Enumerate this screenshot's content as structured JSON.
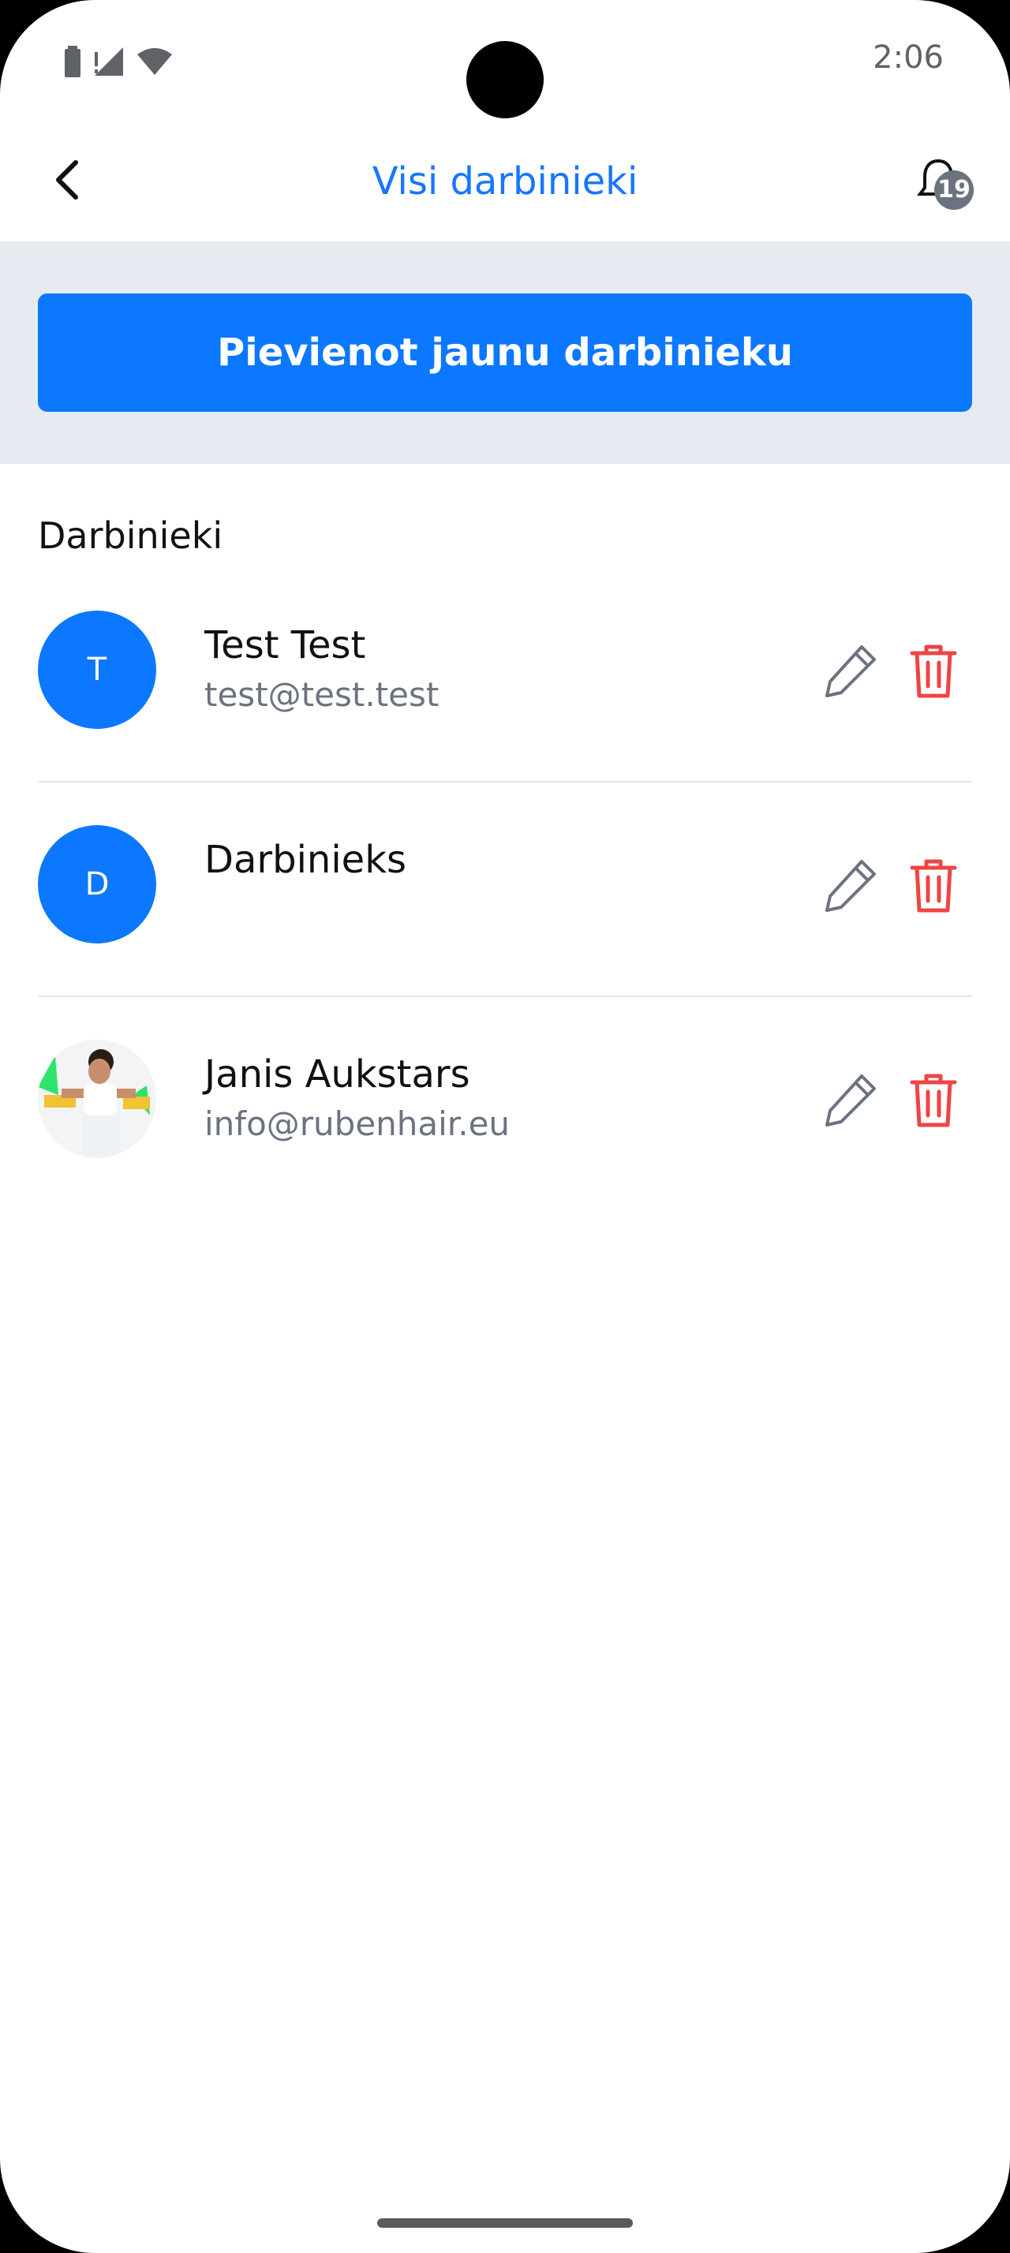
{
  "status_bar": {
    "time": "2:06",
    "icons": [
      "battery-icon",
      "no-signal-icon",
      "wifi-icon"
    ]
  },
  "header": {
    "title": "Visi darbinieki",
    "back_icon": "chevron-left-icon",
    "notifications_icon": "bell-icon",
    "notifications_count": "19"
  },
  "actions": {
    "add_employee_label": "Pievienot jaunu darbinieku"
  },
  "employees_section": {
    "title": "Darbinieki",
    "items": [
      {
        "initial": "T",
        "name": "Test Test",
        "email": "test@test.test",
        "has_photo": false
      },
      {
        "initial": "D",
        "name": "Darbinieks",
        "email": "",
        "has_photo": false
      },
      {
        "initial": "",
        "name": "Janis Aukstars",
        "email": "info@rubenhair.eu",
        "has_photo": true
      }
    ]
  },
  "colors": {
    "accent": "#0b78ff",
    "title": "#1677ff",
    "delete": "#ef4444",
    "muted": "#6b7280",
    "section_bg": "#e6eaf1"
  }
}
